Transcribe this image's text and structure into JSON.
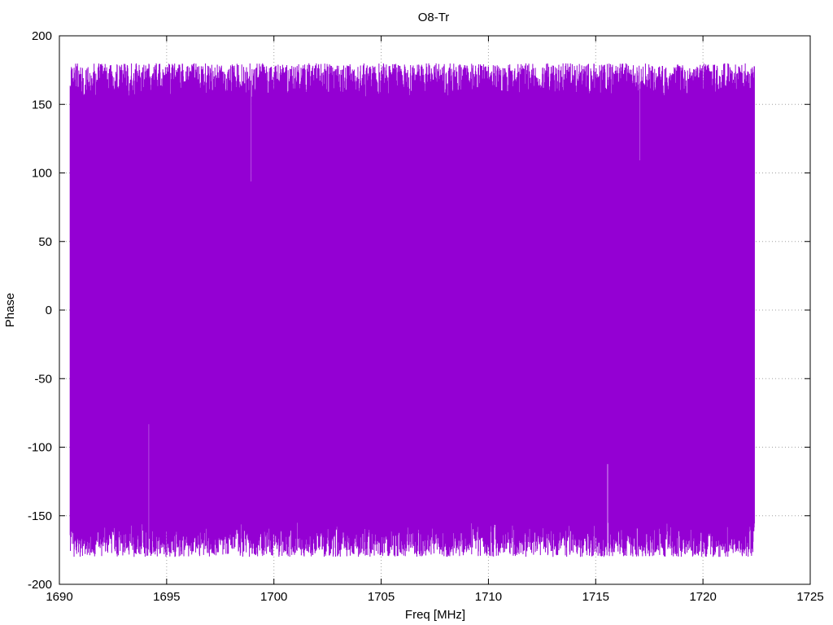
{
  "chart_data": {
    "type": "line",
    "title": "O8-Tr",
    "xlabel": "Freq [MHz]",
    "ylabel": "Phase",
    "xlim": [
      1690,
      1725
    ],
    "ylim": [
      -200,
      200
    ],
    "xticks": [
      1690,
      1695,
      1700,
      1705,
      1710,
      1715,
      1720,
      1725
    ],
    "yticks": [
      -200,
      -150,
      -100,
      -50,
      0,
      50,
      100,
      150,
      200
    ],
    "grid": true,
    "series": [
      {
        "color": "#9400d3",
        "x_range": [
          1690.5,
          1722.4
        ],
        "y_range": [
          -180,
          180
        ],
        "pattern": "dense wrapped phase oscillation between -180 and 180"
      }
    ]
  }
}
